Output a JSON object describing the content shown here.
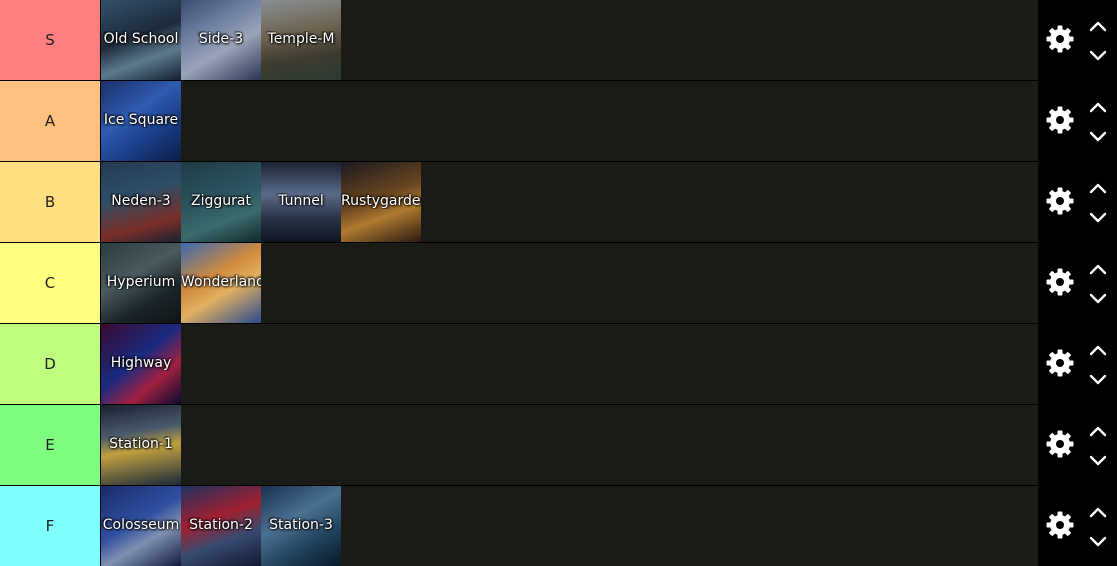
{
  "tiers": [
    {
      "label": "S",
      "color": "#ff7f7f",
      "items": [
        {
          "name": "Old School",
          "bg": "linear-gradient(160deg,#35506a 0%,#1d2a3a 45%,#5d7a8c 70%,#142030 100%)"
        },
        {
          "name": "Side-3",
          "bg": "linear-gradient(150deg,#3b4a6e 0%,#7a88a8 40%,#9aa4b8 60%,#2c3450 100%)"
        },
        {
          "name": "Temple-M",
          "bg": "linear-gradient(170deg,#8a8f94 0%,#6d6452 40%,#3e3a30 70%,#2a3a30 100%)"
        }
      ]
    },
    {
      "label": "A",
      "color": "#ffbf7f",
      "items": [
        {
          "name": "Ice Square",
          "bg": "linear-gradient(145deg,#1a2f6a 0%,#2f5bb0 40%,#1b3f8a 65%,#0d1e45 100%)"
        }
      ]
    },
    {
      "label": "B",
      "color": "#ffdf7f",
      "items": [
        {
          "name": "Neden-3",
          "bg": "linear-gradient(165deg,#243a52 0%,#2e4e66 40%,#7a2e28 75%,#1a2232 100%)"
        },
        {
          "name": "Ziggurat",
          "bg": "linear-gradient(160deg,#1f3a44 0%,#2d5560 45%,#3a6a6a 70%,#15282e 100%)"
        },
        {
          "name": "Tunnel",
          "bg": "linear-gradient(180deg,#1a2230 0%,#5a6a88 40%,#2a3448 70%,#0f1520 100%)"
        },
        {
          "name": "Rustygarden",
          "bg": "linear-gradient(160deg,#1a1a20 0%,#6a4620 45%,#b07a30 65%,#2a1a10 100%)"
        }
      ]
    },
    {
      "label": "C",
      "color": "#ffff7f",
      "items": [
        {
          "name": "Hyperium",
          "bg": "linear-gradient(150deg,#2a3a40 0%,#4a5a5e 40%,#1a2428 70%,#0e1416 100%)"
        },
        {
          "name": "Wonderland",
          "bg": "linear-gradient(150deg,#3a6ab0 0%,#d08a40 40%,#e0b060 60%,#2a4a90 100%)"
        }
      ]
    },
    {
      "label": "D",
      "color": "#bfff7f",
      "items": [
        {
          "name": "Highway",
          "bg": "linear-gradient(140deg,#3a0a30 0%,#1a2a80 45%,#a02040 70%,#0a0a30 100%)"
        }
      ]
    },
    {
      "label": "E",
      "color": "#7fff7f",
      "items": [
        {
          "name": "Station-1",
          "bg": "linear-gradient(170deg,#1a2030 0%,#4a5a6a 35%,#c0a040 55%,#1a2a3a 100%)"
        }
      ]
    },
    {
      "label": "F",
      "color": "#7fffff",
      "items": [
        {
          "name": "Colosseum",
          "bg": "linear-gradient(150deg,#1a2a6a 0%,#3050a0 45%,#8090b0 65%,#101a40 100%)"
        },
        {
          "name": "Station-2",
          "bg": "linear-gradient(160deg,#203060 0%,#a02030 40%,#3a4a70 65%,#101830 100%)"
        },
        {
          "name": "Station-3",
          "bg": "linear-gradient(150deg,#1a3050 0%,#4a7090 40%,#20405a 70%,#0a1828 100%)"
        }
      ]
    }
  ]
}
